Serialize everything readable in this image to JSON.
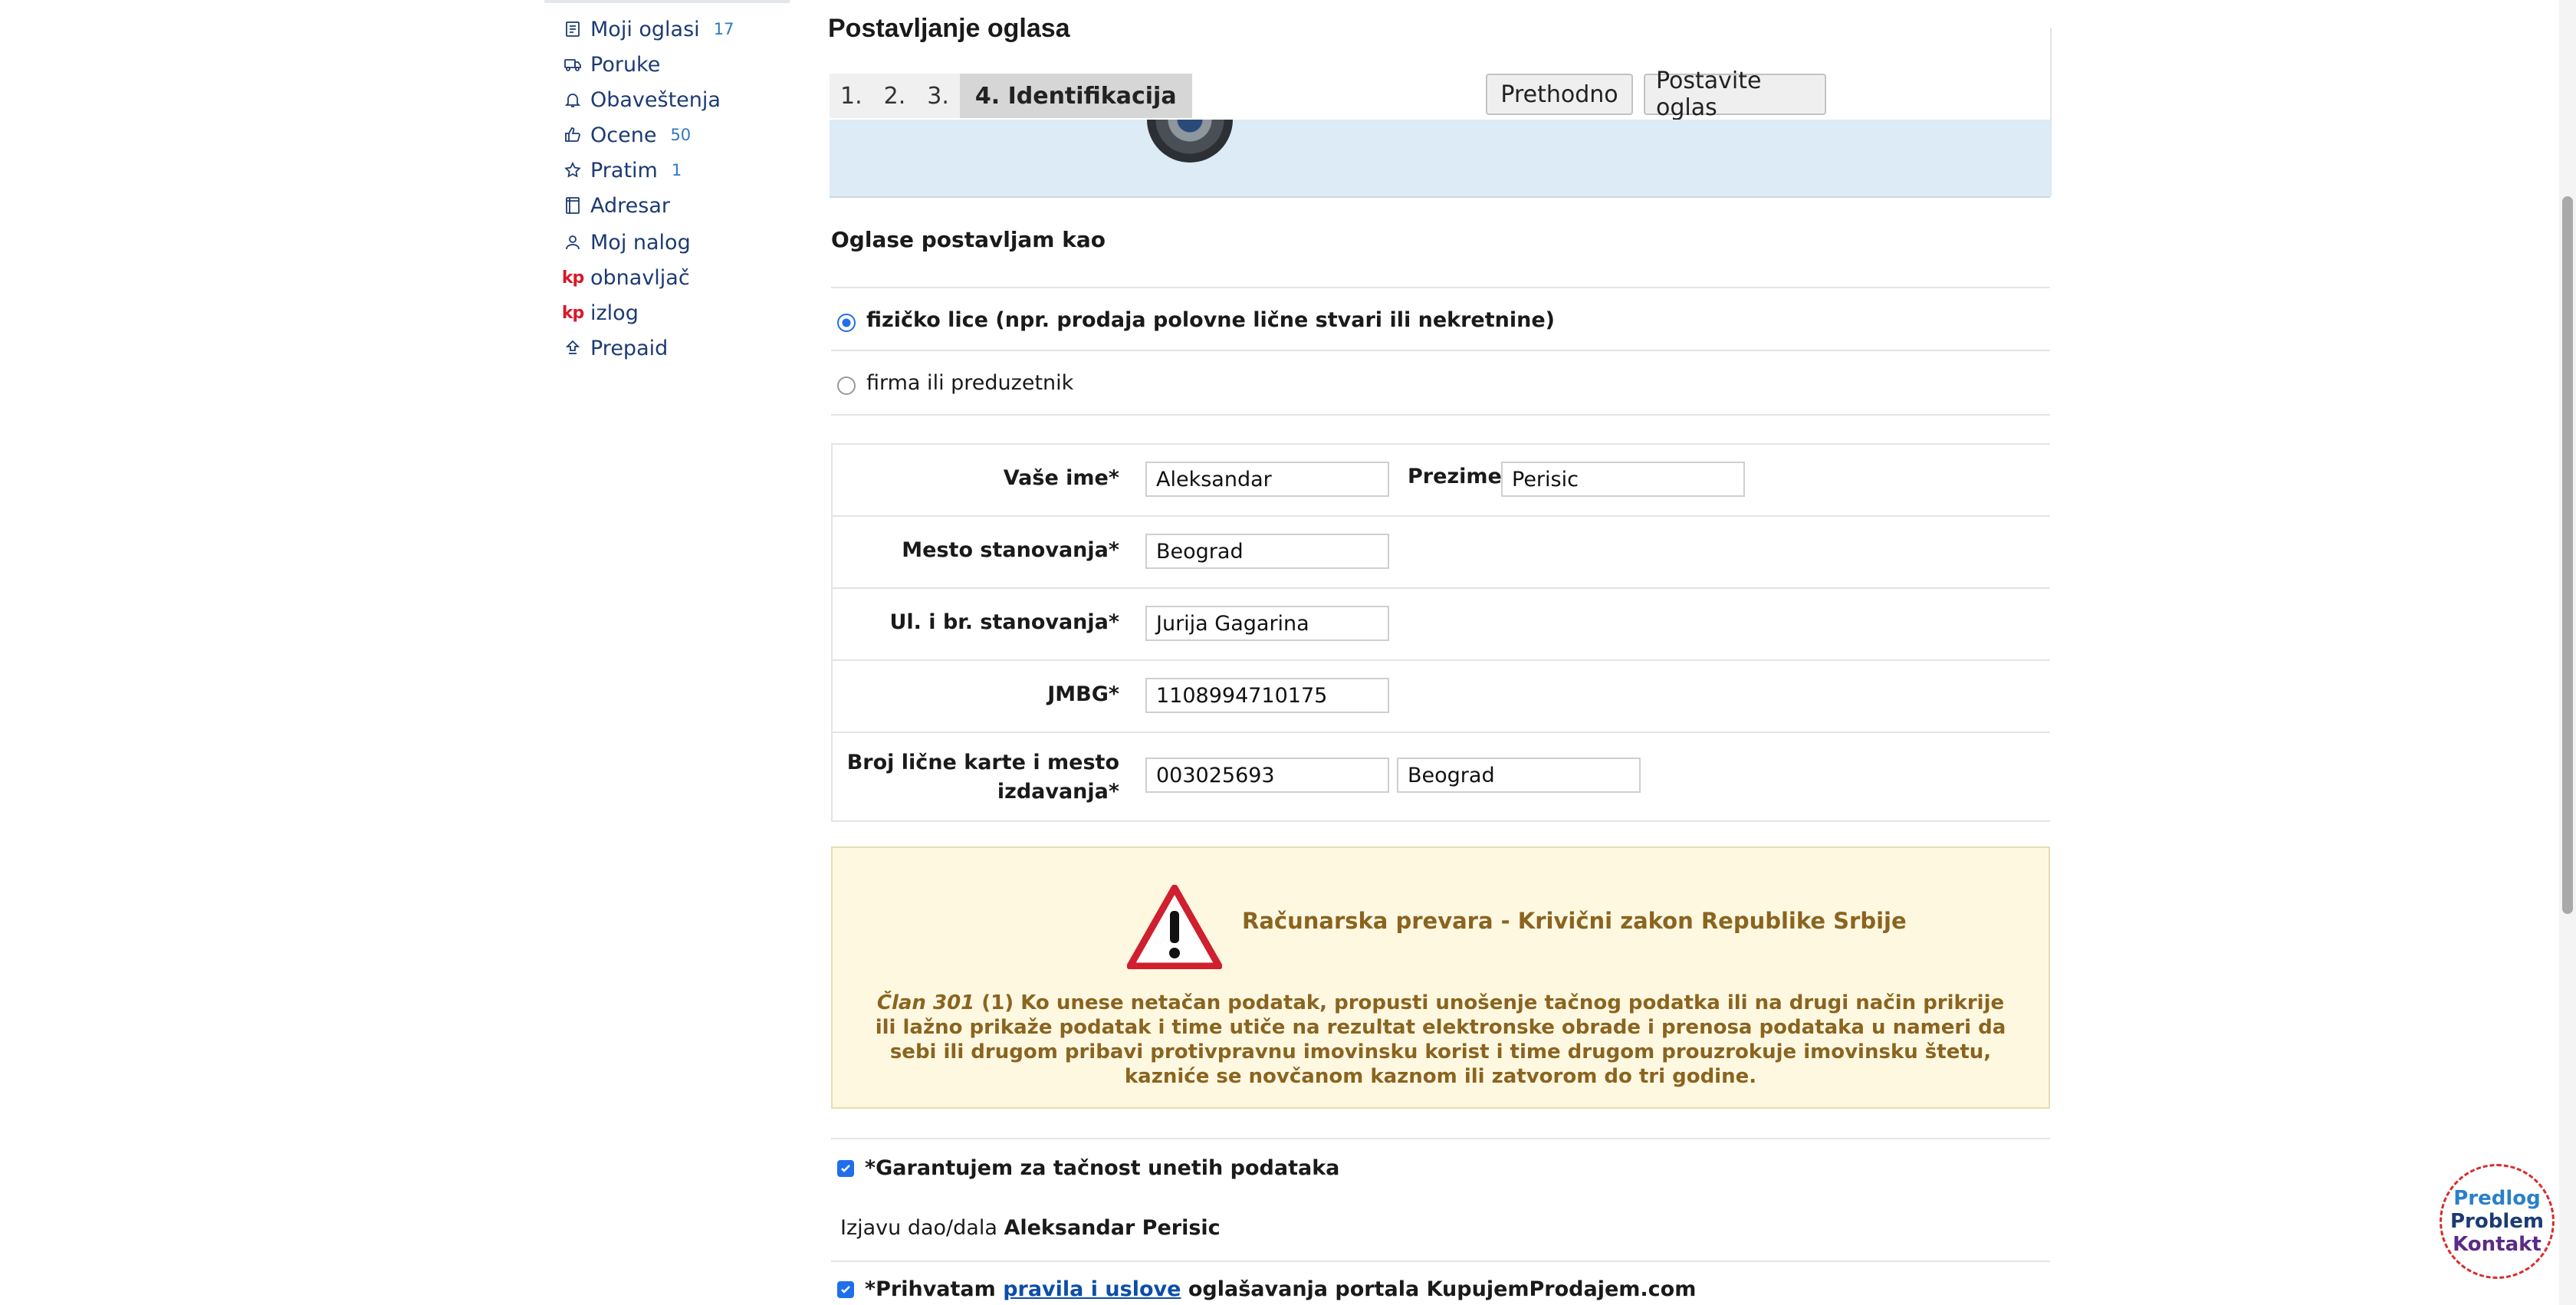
{
  "sidebar": {
    "items": [
      {
        "label": "Moji oglasi",
        "badge": "17",
        "icon": "list-icon"
      },
      {
        "label": "Poruke",
        "icon": "truck-icon"
      },
      {
        "label": "Obaveštenja",
        "icon": "bell-icon"
      },
      {
        "label": "Ocene",
        "badge": "50",
        "icon": "thumb-up-icon"
      },
      {
        "label": "Pratim",
        "badge": "1",
        "icon": "star-icon"
      },
      {
        "label": "Adresar",
        "icon": "address-book-icon"
      },
      {
        "label": "Moj nalog",
        "icon": "user-icon"
      },
      {
        "label": "obnavljač",
        "icon": "kp-logo",
        "kp": "kp"
      },
      {
        "label": "izlog",
        "icon": "kp-logo",
        "kp": "kp"
      },
      {
        "label": "Prepaid",
        "icon": "upload-icon"
      }
    ]
  },
  "main": {
    "title": "Postavljanje oglasa",
    "steps": [
      "1.",
      "2.",
      "3.",
      "4. Identifikacija"
    ],
    "buttons": {
      "prev": "Prethodno",
      "submit": "Postavite oglas"
    },
    "section_label": "Oglase postavljam kao",
    "radio_options": [
      {
        "label": "fizičko lice (npr. prodaja polovne lične stvari ili nekretnine)",
        "selected": true
      },
      {
        "label": "firma ili preduzetnik",
        "selected": false
      }
    ],
    "form": {
      "first_name_label": "Vaše ime*",
      "first_name_value": "Aleksandar",
      "last_name_label": "Prezime*",
      "last_name_value": "Perisic",
      "city_label": "Mesto stanovanja*",
      "city_value": "Beograd",
      "street_label": "Ul. i br. stanovanja*",
      "street_value": "Jurija Gagarina",
      "jmbg_label": "JMBG*",
      "jmbg_value": "1108994710175",
      "id_label_line1": "Broj lične karte i mesto",
      "id_label_line2": "izdavanja*",
      "id_number_value": "003025693",
      "id_place_value": "Beograd"
    },
    "warning": {
      "title": "Računarska prevara - Krivični zakon Republike Srbije",
      "article": "Član 301",
      "text": " (1) Ko unese netačan podatak, propusti unošenje tačnog podatka ili na drugi način prikrije ili lažno prikaže podatak i time utiče na rezultat elektronske obrade i prenosa podataka u nameri da sebi ili drugom pribavi protivpravnu imovinsku korist i time drugom prouzrokuje imovinsku štetu, kazniće se novčanom kaznom ili zatvorom do tri godine."
    },
    "confirm": {
      "guarantee_label": "*Garantujem za tačnost unetih podataka",
      "declaration_prefix": "Izjavu dao/dala ",
      "declaration_name": "Aleksandar Perisic",
      "terms_prefix": "*Prihvatam ",
      "terms_link": "pravila i uslove",
      "terms_suffix": " oglašavanja portala KupujemProdajem.com"
    }
  },
  "feedback": {
    "line1": "Predlog",
    "line2": "Problem",
    "line3": "Kontakt"
  },
  "colors": {
    "accent": "#1f6feb",
    "link": "#1d3b73",
    "warning_text": "#8a6420",
    "warning_bg": "#fff8e1"
  }
}
